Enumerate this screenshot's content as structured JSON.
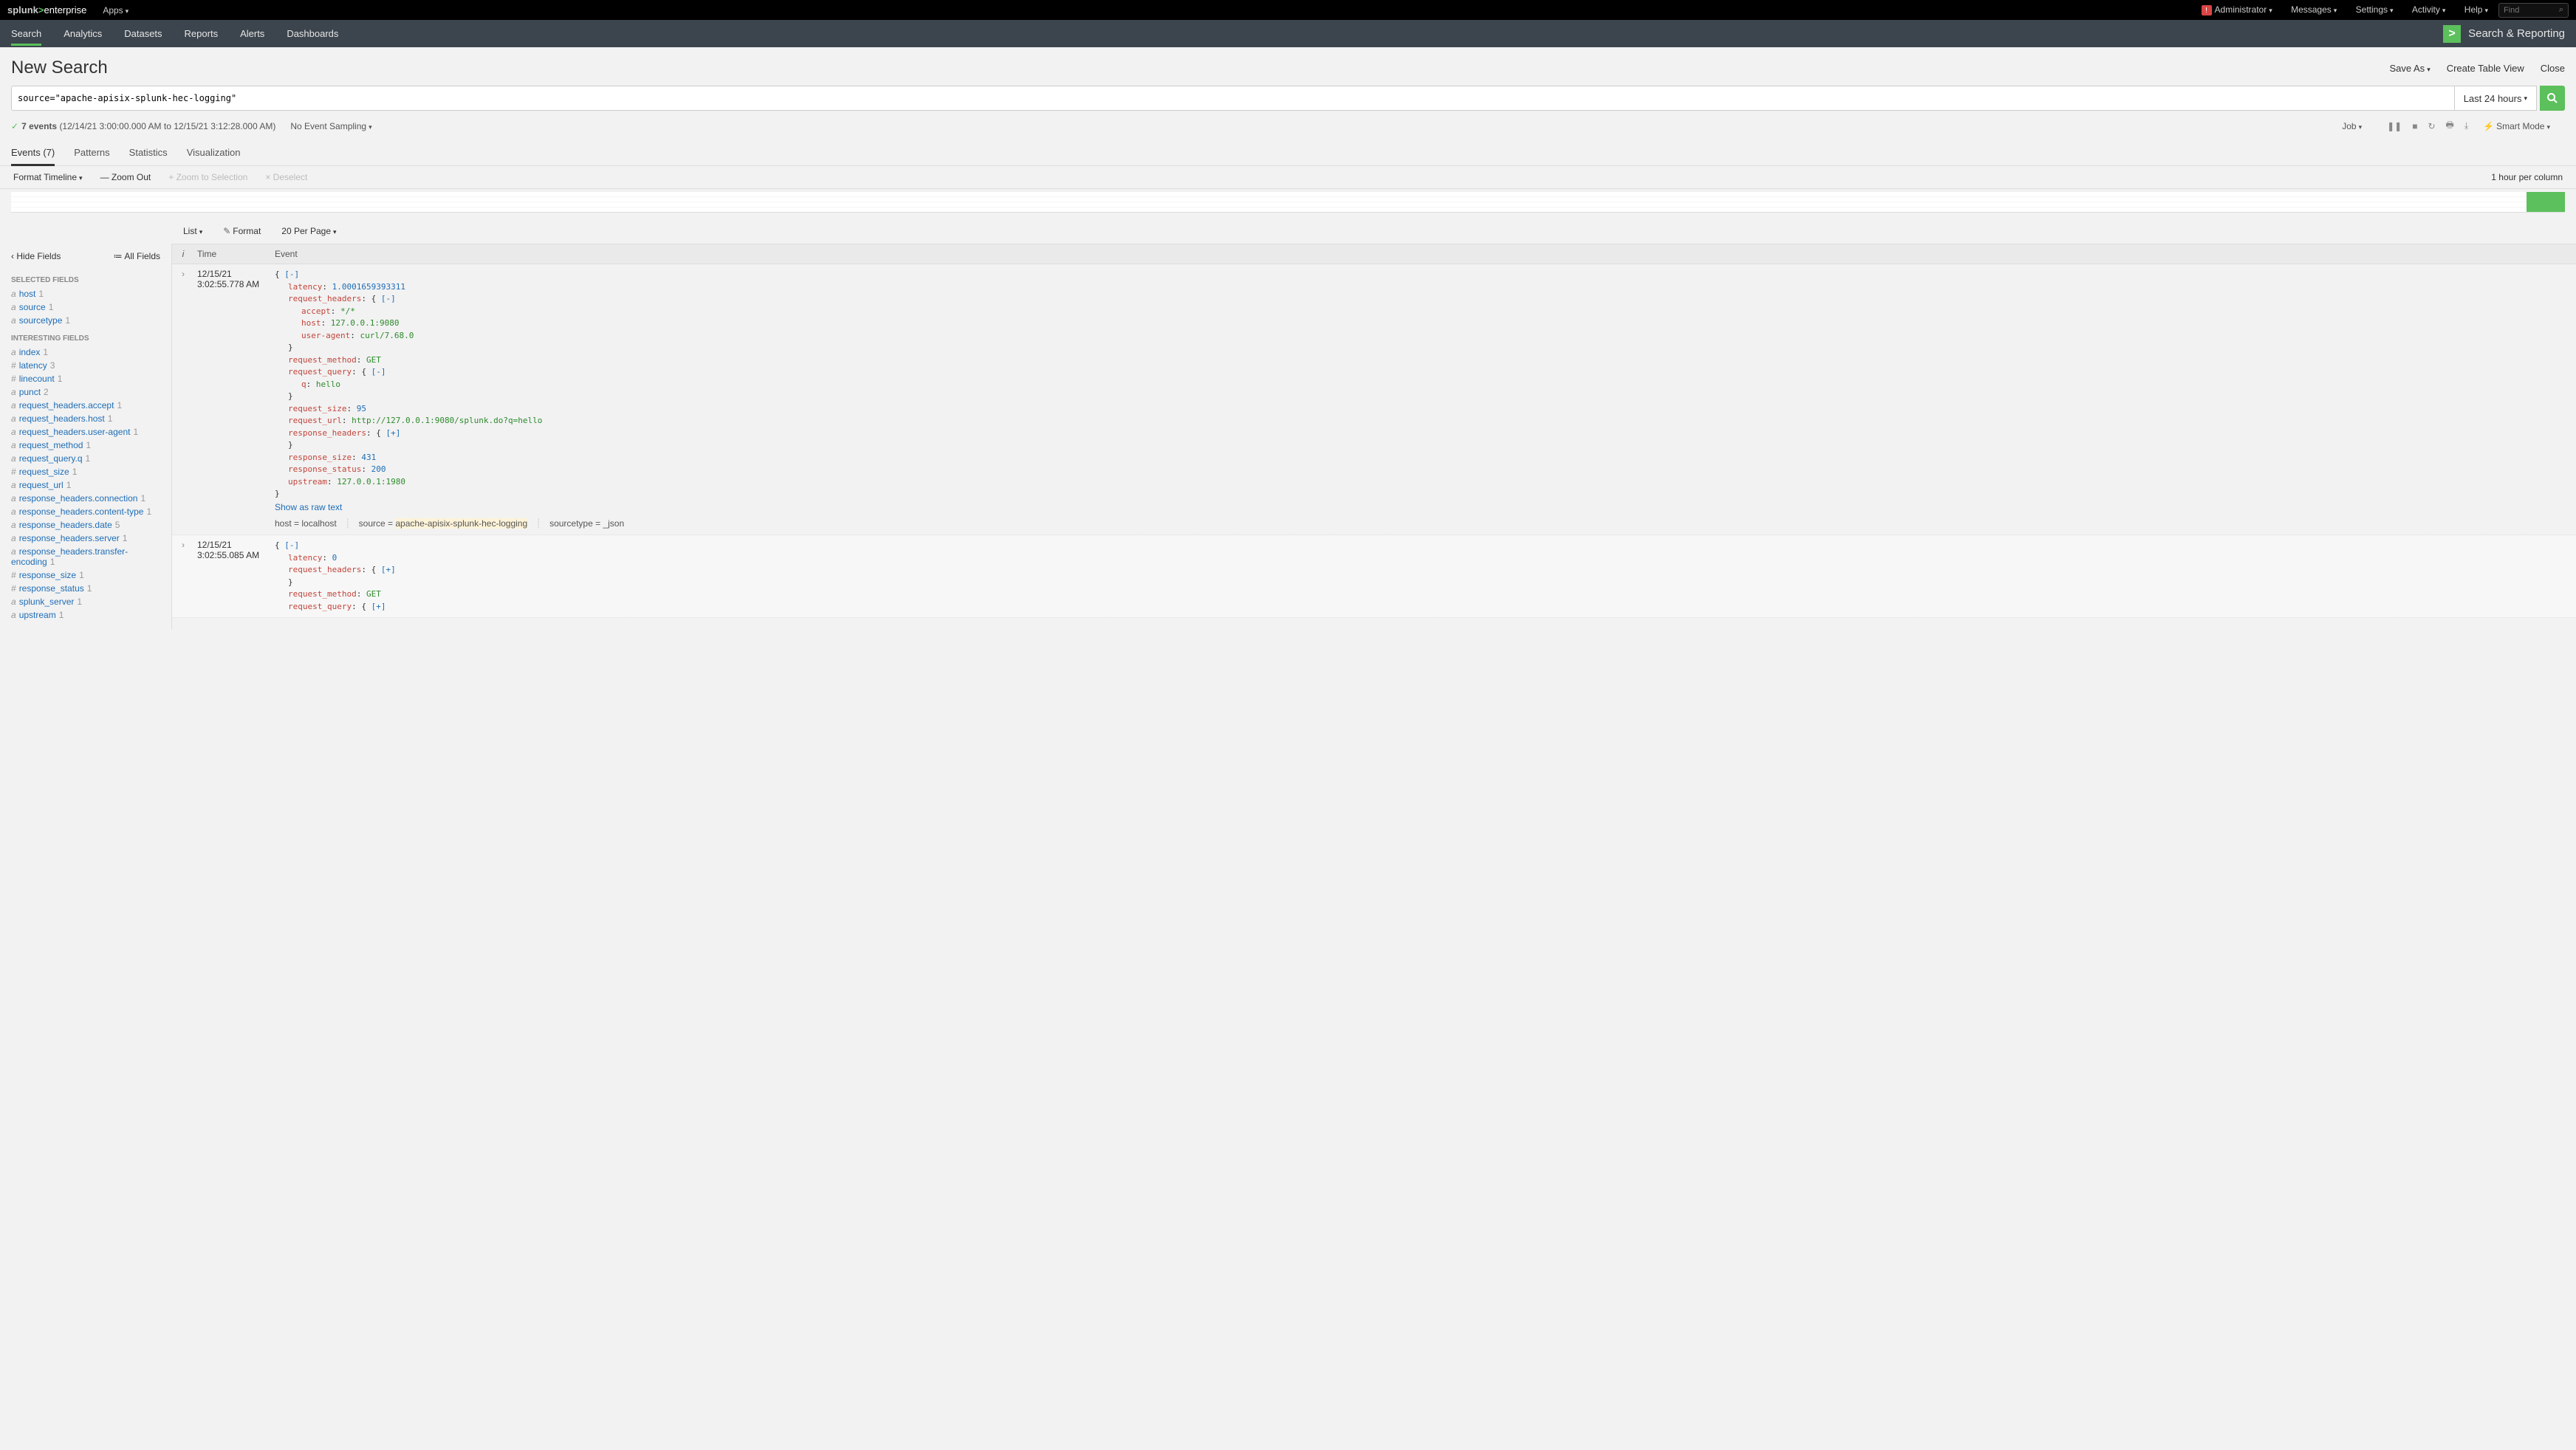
{
  "brand": {
    "prefix": "splunk",
    "gt": ">",
    "suffix": "enterprise"
  },
  "topbar": {
    "apps": "Apps",
    "admin": "Administrator",
    "messages": "Messages",
    "settings": "Settings",
    "activity": "Activity",
    "help": "Help",
    "find_placeholder": "Find"
  },
  "nav": {
    "items": [
      "Search",
      "Analytics",
      "Datasets",
      "Reports",
      "Alerts",
      "Dashboards"
    ],
    "active": 0,
    "app_title": "Search & Reporting"
  },
  "page": {
    "title": "New Search",
    "save_as": "Save As",
    "create_table": "Create Table View",
    "close": "Close"
  },
  "search": {
    "query": "source=\"apache-apisix-splunk-hec-logging\"",
    "time_range": "Last 24 hours"
  },
  "status": {
    "count_bold": "7 events",
    "range": "(12/14/21 3:00:00.000 AM to 12/15/21 3:12:28.000 AM)",
    "sampling": "No Event Sampling",
    "job": "Job",
    "mode": "Smart Mode"
  },
  "tabs": [
    "Events (7)",
    "Patterns",
    "Statistics",
    "Visualization"
  ],
  "timeline": {
    "format": "Format Timeline",
    "zoom_out": "— Zoom Out",
    "zoom_sel": "+ Zoom to Selection",
    "deselect": "× Deselect",
    "scale": "1 hour per column"
  },
  "results_toolbar": {
    "list": "List",
    "format": "Format",
    "per_page": "20 Per Page"
  },
  "fields": {
    "hide": "Hide Fields",
    "all": "All Fields",
    "selected_title": "SELECTED FIELDS",
    "interesting_title": "INTERESTING FIELDS",
    "selected": [
      {
        "t": "a",
        "n": "host",
        "c": 1
      },
      {
        "t": "a",
        "n": "source",
        "c": 1
      },
      {
        "t": "a",
        "n": "sourcetype",
        "c": 1
      }
    ],
    "interesting": [
      {
        "t": "a",
        "n": "index",
        "c": 1
      },
      {
        "t": "#",
        "n": "latency",
        "c": 3
      },
      {
        "t": "#",
        "n": "linecount",
        "c": 1
      },
      {
        "t": "a",
        "n": "punct",
        "c": 2
      },
      {
        "t": "a",
        "n": "request_headers.accept",
        "c": 1
      },
      {
        "t": "a",
        "n": "request_headers.host",
        "c": 1
      },
      {
        "t": "a",
        "n": "request_headers.user-agent",
        "c": 1
      },
      {
        "t": "a",
        "n": "request_method",
        "c": 1
      },
      {
        "t": "a",
        "n": "request_query.q",
        "c": 1
      },
      {
        "t": "#",
        "n": "request_size",
        "c": 1
      },
      {
        "t": "a",
        "n": "request_url",
        "c": 1
      },
      {
        "t": "a",
        "n": "response_headers.connection",
        "c": 1
      },
      {
        "t": "a",
        "n": "response_headers.content-type",
        "c": 1
      },
      {
        "t": "a",
        "n": "response_headers.date",
        "c": 5
      },
      {
        "t": "a",
        "n": "response_headers.server",
        "c": 1
      },
      {
        "t": "a",
        "n": "response_headers.transfer-encoding",
        "c": 1
      },
      {
        "t": "#",
        "n": "response_size",
        "c": 1
      },
      {
        "t": "#",
        "n": "response_status",
        "c": 1
      },
      {
        "t": "a",
        "n": "splunk_server",
        "c": 1
      },
      {
        "t": "a",
        "n": "upstream",
        "c": 1
      }
    ]
  },
  "table": {
    "col_i": "i",
    "col_time": "Time",
    "col_event": "Event"
  },
  "events": [
    {
      "date": "12/15/21",
      "time": "3:02:55.778 AM",
      "json": {
        "latency": "1.0001659393311",
        "accept": "*/*",
        "host_hdr": "127.0.0.1:9080",
        "ua": "curl/7.68.0",
        "method": "GET",
        "q": "hello",
        "req_size": "95",
        "req_url": "http://127.0.0.1:9080/splunk.do?q=hello",
        "resp_size": "431",
        "resp_status": "200",
        "upstream": "127.0.0.1:1980"
      },
      "raw_link": "Show as raw text",
      "meta": {
        "host_label": "host =",
        "host": "localhost",
        "source_label": "source =",
        "source": "apache-apisix-splunk-hec-logging",
        "st_label": "sourcetype =",
        "st": "_json"
      }
    },
    {
      "date": "12/15/21",
      "time": "3:02:55.085 AM",
      "json": {
        "latency": "0",
        "method": "GET"
      }
    }
  ],
  "jlabels": {
    "latency": "latency",
    "request_headers": "request_headers",
    "accept": "accept",
    "host": "host",
    "user_agent": "user-agent",
    "request_method": "request_method",
    "request_query": "request_query",
    "q": "q",
    "request_size": "request_size",
    "request_url": "request_url",
    "response_headers": "response_headers",
    "response_size": "response_size",
    "response_status": "response_status",
    "upstream": "upstream"
  }
}
